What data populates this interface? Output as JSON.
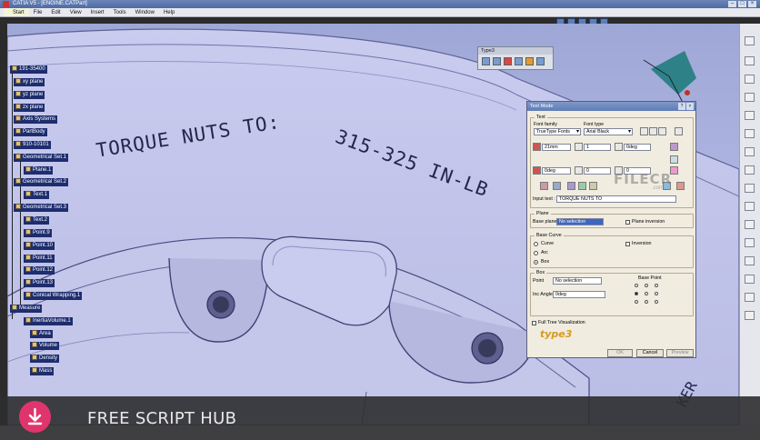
{
  "window": {
    "title": "CATIA V5 - [ENGINE.CATPart]"
  },
  "menu": [
    "Start",
    "File",
    "Edit",
    "View",
    "Insert",
    "Tools",
    "Window",
    "Help"
  ],
  "engraving": {
    "line1": "TORQUE NUTS TO:",
    "line2": "315-325 IN-LB",
    "fragment": "KER"
  },
  "tree": [
    {
      "label": "191-35400"
    },
    {
      "label": "xy plane"
    },
    {
      "label": "yz plane"
    },
    {
      "label": "zx plane"
    },
    {
      "label": "Axis Systems"
    },
    {
      "label": "PartBody"
    },
    {
      "label": "910-10101"
    },
    {
      "label": "Geometrical Set.1"
    },
    {
      "label": "Plane.1"
    },
    {
      "label": "Geometrical Set.2"
    },
    {
      "label": "Text.1"
    },
    {
      "label": "Geometrical Set.3"
    },
    {
      "label": "Text.2"
    },
    {
      "label": "Point.9"
    },
    {
      "label": "Point.10"
    },
    {
      "label": "Point.11"
    },
    {
      "label": "Point.12"
    },
    {
      "label": "Point.13"
    },
    {
      "label": "Conical Wrapping.1"
    },
    {
      "label": "Measure"
    },
    {
      "label": "InertiaVolume.1"
    },
    {
      "label": "Area"
    },
    {
      "label": "Volume"
    },
    {
      "label": "Density"
    },
    {
      "label": "Mass"
    }
  ],
  "type3_palette": {
    "title": "Type3"
  },
  "dialog": {
    "title": "Text Mode",
    "text_group": "Text",
    "font_family_label": "Font family",
    "font_family_value": "TrueType Fonts",
    "font_type_label": "Font type",
    "font_type_value": "Arial Black",
    "size_value": "21mm",
    "spacing_value": "1",
    "angle_value": "0deg",
    "slant_value": "0deg",
    "field_5": "0",
    "field_6": "0",
    "input_text_label": "Input text :",
    "input_text_value": "TORQUE NUTS TO",
    "plane_group": "Plane",
    "base_plane_label": "Base plane",
    "base_plane_value": "No selection",
    "plane_inversion_label": "Plane inversion",
    "base_curve_group": "Base Curve",
    "curve_label": "Curve",
    "inversion_label": "Inversion",
    "arc_label": "Arc",
    "box_label": "Box",
    "box_group": "Box",
    "point_label": "Point",
    "point_value": "No selection",
    "inc_angle_label": "Inc Angle",
    "inc_angle_value": "0deg",
    "base_point_label": "Base Point",
    "full_tree_label": "Full Tree Visualization",
    "logo": "type3",
    "ok_label": "OK",
    "cancel_label": "Cancel",
    "preview_label": "Preview"
  },
  "watermark": {
    "text": "FILECR",
    "sub": ".com"
  },
  "banner": {
    "text": "FREE SCRIPT HUB"
  },
  "colors": {
    "viewport": "#aeb4e0",
    "tree_highlight": "#1d2d6e",
    "banner_accent": "#e0356c"
  }
}
